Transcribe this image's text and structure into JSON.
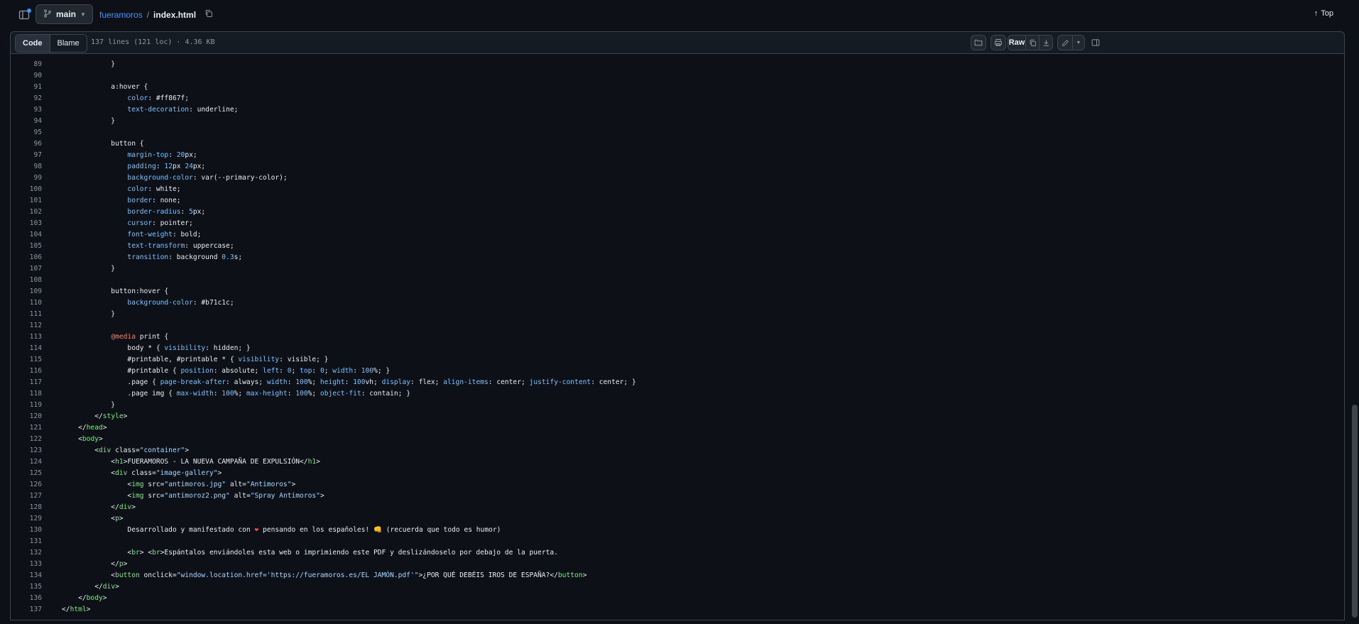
{
  "header": {
    "branch": "main",
    "repo": "fueramoros",
    "separator": "/",
    "file": "index.html",
    "top_label": "Top"
  },
  "file_header": {
    "tabs": [
      "Code",
      "Blame"
    ],
    "meta": "137 lines (121 loc) · 4.36 KB",
    "raw_label": "Raw"
  },
  "code": {
    "line_numbers": [
      "89",
      "90",
      "91",
      "92",
      "93",
      "94",
      "95",
      "96",
      "97",
      "98",
      "99",
      "100",
      "101",
      "102",
      "103",
      "104",
      "105",
      "106",
      "107",
      "108",
      "109",
      "110",
      "111",
      "112",
      "113",
      "114",
      "115",
      "116",
      "117",
      "118",
      "119",
      "120",
      "121",
      "122",
      "123",
      "124",
      "125",
      "126",
      "127",
      "128",
      "129",
      "130",
      "131",
      "132",
      "133",
      "134",
      "135",
      "136",
      "137"
    ],
    "lines": [
      "            }",
      "",
      "            a:hover {",
      "                color: #ff867f;",
      "                text-decoration: underline;",
      "            }",
      "",
      "            button {",
      "                margin-top: 20px;",
      "                padding: 12px 24px;",
      "                background-color: var(--primary-color);",
      "                color: white;",
      "                border: none;",
      "                border-radius: 5px;",
      "                cursor: pointer;",
      "                font-weight: bold;",
      "                text-transform: uppercase;",
      "                transition: background 0.3s;",
      "            }",
      "",
      "            button:hover {",
      "                background-color: #b71c1c;",
      "            }",
      "",
      "            @media print {",
      "                body * { visibility: hidden; }",
      "                #printable, #printable * { visibility: visible; }",
      "                #printable { position: absolute; left: 0; top: 0; width: 100%; }",
      "                .page { page-break-after: always; width: 100%; height: 100vh; display: flex; align-items: center; justify-content: center; }",
      "                .page img { max-width: 100%; max-height: 100%; object-fit: contain; }",
      "            }",
      "        </style>",
      "    </head>",
      "    <body>",
      "        <div class=\"container\">",
      "            <h1>FUERAMOROS - LA NUEVA CAMPAÑA DE EXPULSIÓN</h1>",
      "            <div class=\"image-gallery\">",
      "                <img src=\"antimoros.jpg\" alt=\"Antimoros\">",
      "                <img src=\"antimoroz2.png\" alt=\"Spray Antimoros\">",
      "            </div>",
      "            <p>",
      "                Desarrollado y manifestado con ❤ pensando en los españoles! 👊 (recuerda que todo es humor)",
      "",
      "                <br> <br>Espántalos enviándoles esta web o imprimiendo este PDF y deslizándoselo por debajo de la puerta.",
      "            </p>",
      "            <button onclick=\"window.location.href='https://fueramoros.es/EL JAMÓN.pdf'\">¿POR QUÉ DEBÉIS IROS DE ESPAÑA?</button>",
      "        </div>",
      "    </body>",
      "</html>"
    ]
  },
  "colors": {
    "background": "#0d1117",
    "link": "#4493f8",
    "tag": "#7ee787",
    "property": "#79c0ff",
    "string": "#a5d6ff",
    "at_rule": "#ff7b72"
  },
  "icons": [
    "sidebar-toggle-icon",
    "branch-icon",
    "chevron-down-icon",
    "copy-icon",
    "arrow-up-icon",
    "folder-icon",
    "print-icon",
    "copy-raw-icon",
    "download-icon",
    "pencil-icon",
    "symbols-icon"
  ]
}
